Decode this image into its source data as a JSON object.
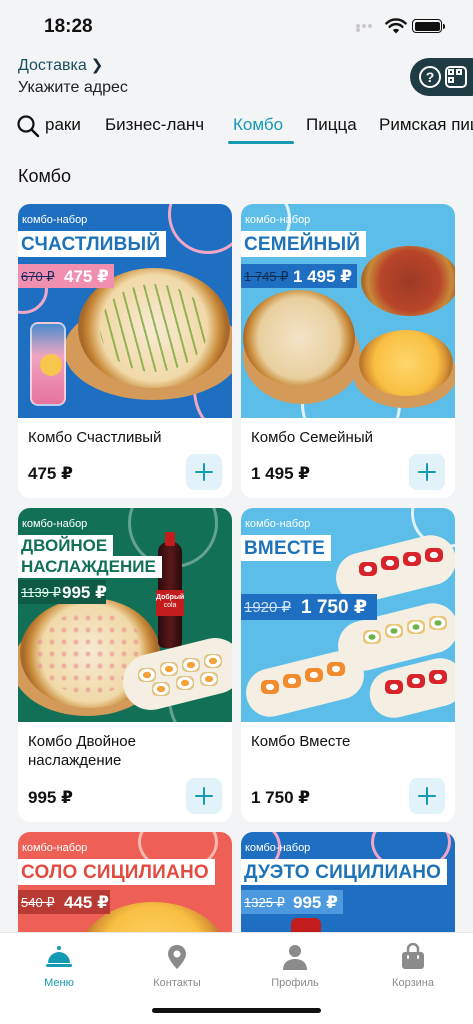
{
  "status": {
    "time": "18:28"
  },
  "header": {
    "delivery": "Доставка",
    "delivery_chevron": "❯",
    "address": "Укажите адрес",
    "help_glyph": "?"
  },
  "categories": [
    {
      "label": "раки"
    },
    {
      "label": "Бизнес-ланч"
    },
    {
      "label": "Комбо",
      "active": true
    },
    {
      "label": "Пицца"
    },
    {
      "label": "Римская пицца"
    }
  ],
  "section_title": "Комбо",
  "products": [
    {
      "name": "Комбо Счастливый",
      "price": "475 ₽",
      "kind": "комбо-набор",
      "plate": "СЧАСТЛИВЫЙ",
      "old": "670 ₽",
      "new": "475 ₽",
      "bg": "#1e6fc2"
    },
    {
      "name": "Комбо Семейный",
      "price": "1 495 ₽",
      "kind": "комбо-набор",
      "plate": "СЕМЕЙНЫЙ",
      "old": "1 745 ₽",
      "new": "1 495 ₽",
      "bg": "#5cbde8"
    },
    {
      "name": "Комбо Двойное наслаждение",
      "price": "995 ₽",
      "kind": "комбо-набор",
      "plate_line1": "ДВОЙНОЕ",
      "plate_line2": "НАСЛАЖДЕНИЕ",
      "old": "1139 ₽",
      "new": "995 ₽",
      "bottle_label": "Добрый",
      "bottle_sub": "cola",
      "bg": "#127057"
    },
    {
      "name": "Комбо Вместе",
      "price": "1 750 ₽",
      "kind": "комбо-набор",
      "plate": "ВМЕСТЕ",
      "old": "1920 ₽",
      "new": "1 750 ₽",
      "bg": "#5cbde8"
    },
    {
      "kind": "комбо-набор",
      "plate": "СОЛО СИЦИЛИАНО",
      "old": "540 ₽",
      "new": "445 ₽",
      "bg": "#ee5f55"
    },
    {
      "kind": "комбо-набор",
      "plate": "ДУЭТО СИЦИЛИАНО",
      "old": "1325 ₽",
      "new": "995 ₽",
      "bg": "#1e6fc2"
    }
  ],
  "tabs": [
    {
      "label": "Меню",
      "icon": "cloche-icon",
      "active": true
    },
    {
      "label": "Контакты",
      "icon": "location-pin-icon"
    },
    {
      "label": "Профиль",
      "icon": "person-icon"
    },
    {
      "label": "Корзина",
      "icon": "shopping-bag-icon"
    }
  ],
  "colors": {
    "accent": "#159ab3",
    "pill": "#1f3b44"
  }
}
